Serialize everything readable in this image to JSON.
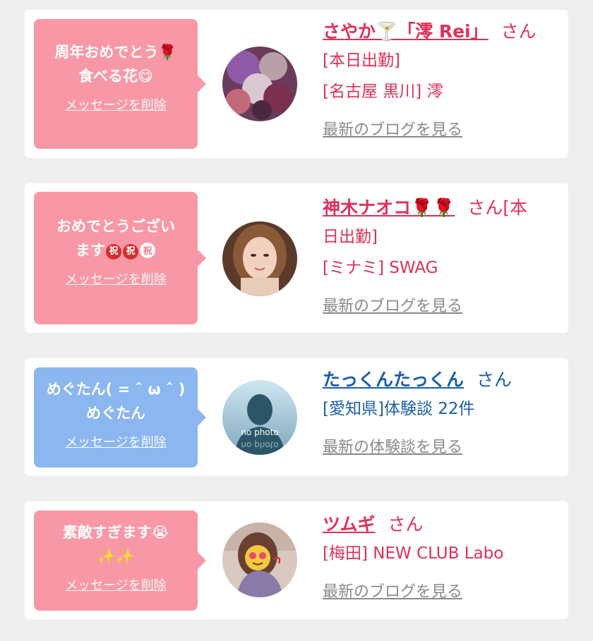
{
  "delete_label": "メッセージを削除",
  "cards": [
    {
      "message_line1": "周年おめでとう🌹",
      "message_line2": "食べる花😋",
      "name": "さやか🍸「澪 Rei」",
      "san": "さん",
      "line1": "[本日出勤]",
      "line2": "[名古屋 黒川] 澪",
      "more": "最新のブログを見る"
    },
    {
      "message_line1": "おめでとうござい",
      "message_line2": "ます",
      "seal_text": "祝",
      "name": "神木ナオコ🌹🌹",
      "san": "さん[本",
      "line1": "日出勤]",
      "line2": "[ミナミ] SWAG",
      "more": "最新のブログを見る"
    },
    {
      "message_line1": "めぐたん( = ˆ ω ˆ )",
      "message_line2": "めぐたん",
      "name": "たっくんたっくん",
      "san": "さん",
      "line1": "[愛知県]体験談 22件",
      "more": "最新の体験談を見る",
      "avatar_text": "no photo"
    },
    {
      "message_line1": "素敵すぎます😭",
      "message_line2": "✨✨",
      "name": "ツムギ",
      "san": "さん",
      "line1": "[梅田] NEW CLUB Labo",
      "more": "最新のブログを見る"
    }
  ],
  "colors": {
    "pink_bubble": "#f898a6",
    "blue_bubble": "#8bb6f0",
    "pink_text": "#e0305a",
    "blue_text": "#1a5fa8"
  }
}
